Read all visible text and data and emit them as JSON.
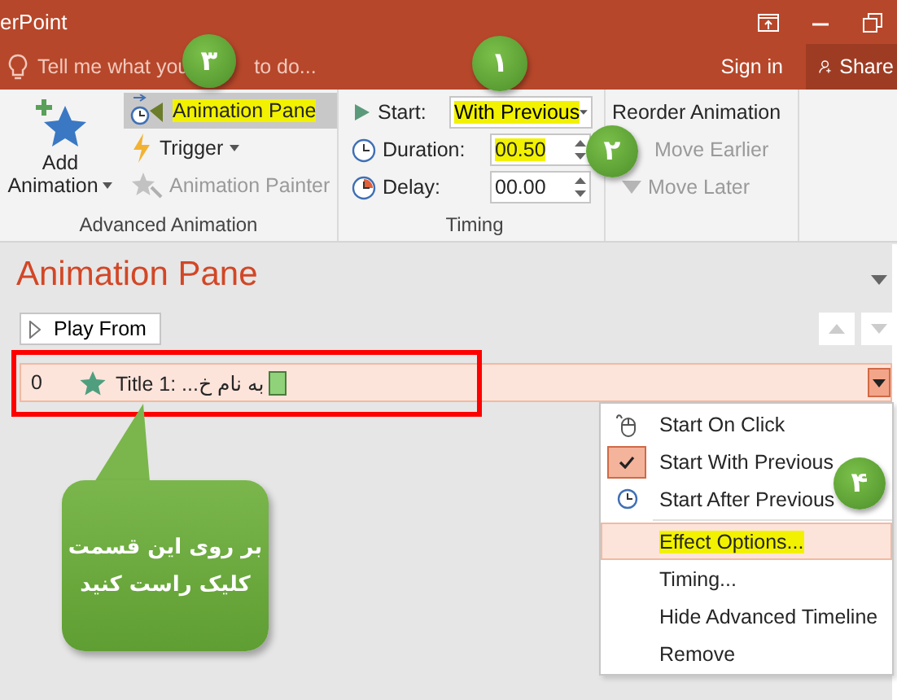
{
  "title_bar": {
    "title": "erPoint"
  },
  "tell_me": {
    "text_before": "Tell me what you",
    "text_after": "to do..."
  },
  "account": {
    "sign_in": "Sign in",
    "share": "Share"
  },
  "advanced_animation": {
    "add_animation": [
      "Add",
      "Animation"
    ],
    "buttons": [
      {
        "label": "Animation Pane",
        "highlighted": true,
        "disabled": false
      },
      {
        "label": "Trigger",
        "highlighted": false,
        "disabled": false
      },
      {
        "label": "Animation Painter",
        "highlighted": false,
        "disabled": true
      }
    ],
    "group_label": "Advanced Animation"
  },
  "timing": {
    "start": {
      "label": "Start:",
      "value": "With Previous",
      "highlighted": true
    },
    "fields": [
      {
        "label": "Duration:",
        "value": "00.50",
        "highlighted": true
      },
      {
        "label": "Delay:",
        "value": "00.00",
        "highlighted": false
      }
    ],
    "group_label": "Timing"
  },
  "reorder": {
    "title": "Reorder Animation",
    "buttons": [
      {
        "label": "Move Earlier",
        "disabled": true
      },
      {
        "label": "Move Later",
        "disabled": true
      }
    ]
  },
  "animation_pane": {
    "title": "Animation Pane",
    "play_button": "Play From",
    "items": [
      {
        "index": "0",
        "label": "Title 1: ...به نام خ",
        "selected": true
      }
    ]
  },
  "context_menu": {
    "items": [
      {
        "label": "Start On Click",
        "checked": false,
        "selected": false
      },
      {
        "label": "Start With Previous",
        "checked": true,
        "selected": false
      },
      {
        "label": "Start After Previous",
        "checked": false,
        "selected": false
      },
      {
        "label": "Effect Options...",
        "checked": false,
        "selected": true,
        "highlighted": true
      },
      {
        "label": "Timing...",
        "checked": false,
        "selected": false
      },
      {
        "label": "Hide Advanced Timeline",
        "checked": false,
        "selected": false
      },
      {
        "label": "Remove",
        "checked": false,
        "selected": false
      }
    ]
  },
  "annotations": {
    "markers": [
      {
        "label": "۱"
      },
      {
        "label": "۲"
      },
      {
        "label": "۳"
      },
      {
        "label": "۴"
      }
    ],
    "callout": {
      "lines": [
        "بر روی این قسمت",
        "کلیک راست کنید"
      ]
    }
  }
}
